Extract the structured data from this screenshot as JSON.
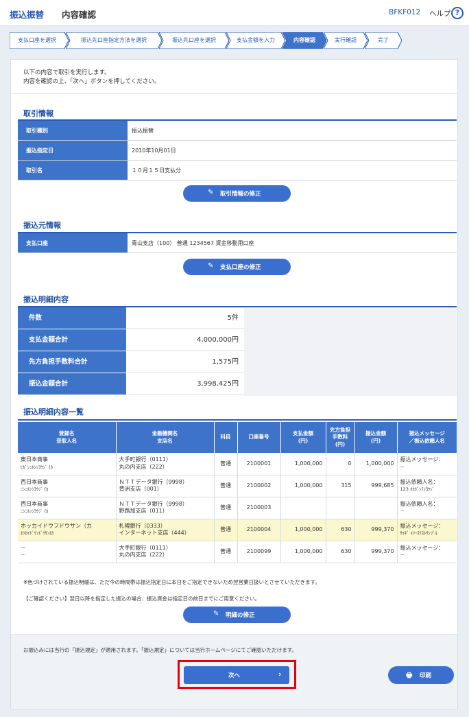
{
  "header": {
    "title_main": "振込振替",
    "title_sub": "内容確認",
    "screen_id": "BFKF012",
    "help_label": "ヘルプ",
    "help_icon": "?"
  },
  "steps": [
    {
      "label": "支払口座を選択",
      "active": false
    },
    {
      "label": "振込先口座指定方法を選択",
      "active": false
    },
    {
      "label": "振込先口座を選択",
      "active": false
    },
    {
      "label": "支払金額を入力",
      "active": false
    },
    {
      "label": "内容確認",
      "active": true
    },
    {
      "label": "実行確認",
      "active": false
    },
    {
      "label": "完了",
      "active": false
    }
  ],
  "intro": {
    "line1": "以下の内容で取引を実行します。",
    "line2": "内容を確認の上、「次へ」ボタンを押してください。"
  },
  "transaction": {
    "title": "取引情報",
    "rows": [
      {
        "key": "取引種別",
        "value": "振込振替"
      },
      {
        "key": "振込指定日",
        "value": "2010年10月01日"
      },
      {
        "key": "取引名",
        "value": "１０月１５日支払分"
      }
    ],
    "edit_label": "取引情報の修正"
  },
  "source": {
    "title": "振込元情報",
    "rows": [
      {
        "key": "支払口座",
        "value": "青山支店（100） 普通 1234567 資金移動用口座"
      }
    ],
    "edit_label": "支払口座の修正"
  },
  "summary": {
    "title": "振込明細内容",
    "rows": [
      {
        "key": "件数",
        "value": "5件"
      },
      {
        "key": "支払金額合計",
        "value": "4,000,000円"
      },
      {
        "key": "先方負担手数料合計",
        "value": "1,575円"
      },
      {
        "key": "振込金額合計",
        "value": "3,998,425円"
      }
    ]
  },
  "detail": {
    "title": "振込明細内容一覧",
    "headers": [
      [
        "登録名",
        "受取人名"
      ],
      [
        "金融機関名",
        "支店名"
      ],
      [
        "科目"
      ],
      [
        "口座番号"
      ],
      [
        "支払金額",
        "(円)"
      ],
      [
        "先方負担",
        "手数料",
        "(円)"
      ],
      [
        "振込金額",
        "(円)"
      ],
      [
        "振込メッセージ",
        "／振込依頼人名"
      ]
    ],
    "rows": [
      {
        "name1": "東日本商事",
        "name2": "ﾋｶﾞｼﾆﾎﾝｼﾖｳｼﾞ (ｶ",
        "bank1": "大手町銀行（0111）",
        "bank2": "丸の内支店（222）",
        "type": "普通",
        "account": "2100001",
        "pay": "1,000,000",
        "fee": "0",
        "amount": "1,000,000",
        "msg1": "振込メッセージ：",
        "msg2": "－",
        "highlight": false
      },
      {
        "name1": "西日本商事",
        "name2": "ﾆｼﾆﾎﾝｼﾖｳｼﾞ (ｶ",
        "bank1": "ＮＴＴデータ銀行（9998）",
        "bank2": "豊洲支店（001）",
        "type": "普通",
        "account": "2100002",
        "pay": "1,000,000",
        "fee": "315",
        "amount": "999,685",
        "msg1": "振込依頼人名：",
        "msg2": "123 ｵｵｶﾞｼﾗｼﾖｳｼﾞ",
        "highlight": false
      },
      {
        "name1": "西日本商事",
        "name2": "ﾆｼﾆﾎﾝｼﾖｳｼﾞ (ｶ",
        "bank1": "ＮＴＴデータ銀行（9998）",
        "bank2": "野路加支店（011）",
        "type": "普通",
        "account": "2100003",
        "pay": "",
        "fee": "",
        "amount": "",
        "msg1": "振込依頼人名：",
        "msg2": "－",
        "highlight": false
      },
      {
        "name1": "ホッカイドウフドウサン（カ",
        "name2": "ﾎﾂｶｲﾄﾞｳﾌﾄﾞｳｻﾝ(ｶ",
        "bank1": "札幌銀行（0333）",
        "bank2": "インターネット支店（444）",
        "type": "普通",
        "account": "2100004",
        "pay": "1,000,000",
        "fee": "630",
        "amount": "999,370",
        "msg1": "振込メッセージ：",
        "msg2": "ｻｲｷﾞ ﾒﾂｰｽﾃｽﾄｻﾝﾌﾟﾙ",
        "highlight": true
      },
      {
        "name1": "－",
        "name2": "－",
        "bank1": "大手町銀行（0111）",
        "bank2": "丸の内支店（222）",
        "type": "普通",
        "account": "2100099",
        "pay": "1,000,000",
        "fee": "630",
        "amount": "999,370",
        "msg1": "振込メッセージ：",
        "msg2": "－",
        "highlight": false
      }
    ],
    "note1": "※色づけされている振込明細は、ただ今の時間帯は振込指定日に本日をご指定できないため翌営業日扱いとさせていただきます。",
    "note2": "【ご確認ください】翌日以降を指定した振込の場合、振込資金は指定日の前日までにご用意ください。",
    "edit_label": "明細の修正"
  },
  "footer": {
    "note": "お振込みには当行の「振込規定」が適用されます。「振込規定」については当行ホームページにてご確認いただけます。",
    "next_label": "次へ",
    "print_label": "印刷"
  },
  "colors": {
    "primary": "#2a5ab8",
    "header_cell": "#3d73c9",
    "button": "#3a6fcf",
    "highlight_row": "#fbf8cf",
    "red_outline": "#e60012"
  }
}
